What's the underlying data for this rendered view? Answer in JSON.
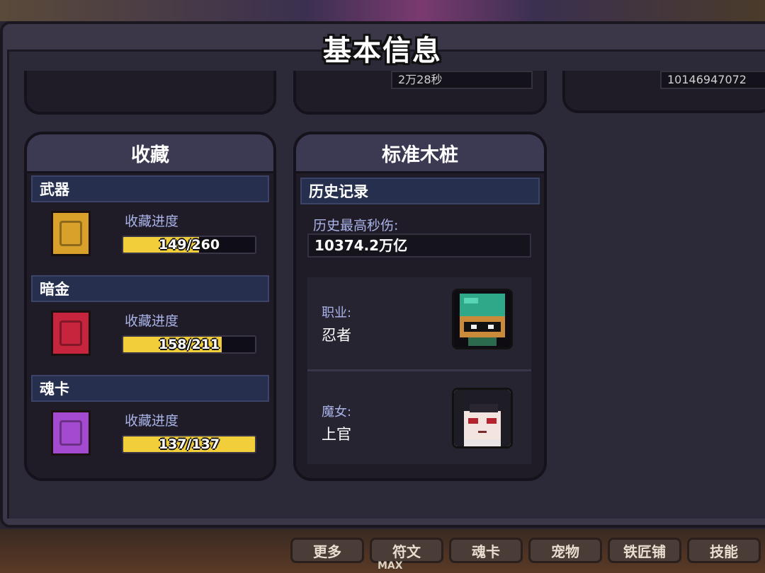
{
  "window": {
    "title": "基本信息"
  },
  "top_stubs": {
    "middle_value": "2万28秒",
    "right_value": "10146947072"
  },
  "collection": {
    "title": "收藏",
    "progress_label": "收藏进度",
    "sections": [
      {
        "name": "武器",
        "text": "149/260",
        "current": 149,
        "total": 260,
        "icon": "weapon-book-icon",
        "color": "#d9a12a"
      },
      {
        "name": "暗金",
        "text": "158/211",
        "current": 158,
        "total": 211,
        "icon": "dark-gold-book-icon",
        "color": "#c7243d"
      },
      {
        "name": "魂卡",
        "text": "137/137",
        "current": 137,
        "total": 137,
        "icon": "soul-card-book-icon",
        "color": "#a34ad1"
      }
    ]
  },
  "dummy": {
    "title": "标准木桩",
    "record_header": "历史记录",
    "max_dps_label": "历史最高秒伤:",
    "max_dps_value": "10374.2万亿",
    "class_label": "职业:",
    "class_value": "忍者",
    "witch_label": "魔女:",
    "witch_value": "上官"
  },
  "bottom_tabs": [
    "更多",
    "符文",
    "魂卡",
    "宠物",
    "铁匠铺",
    "技能"
  ],
  "bottom_max": "MAX",
  "colors": {
    "progress_fill": "#f2cf3a",
    "section_header": "#26304e",
    "label_blue": "#a9b3e8"
  }
}
